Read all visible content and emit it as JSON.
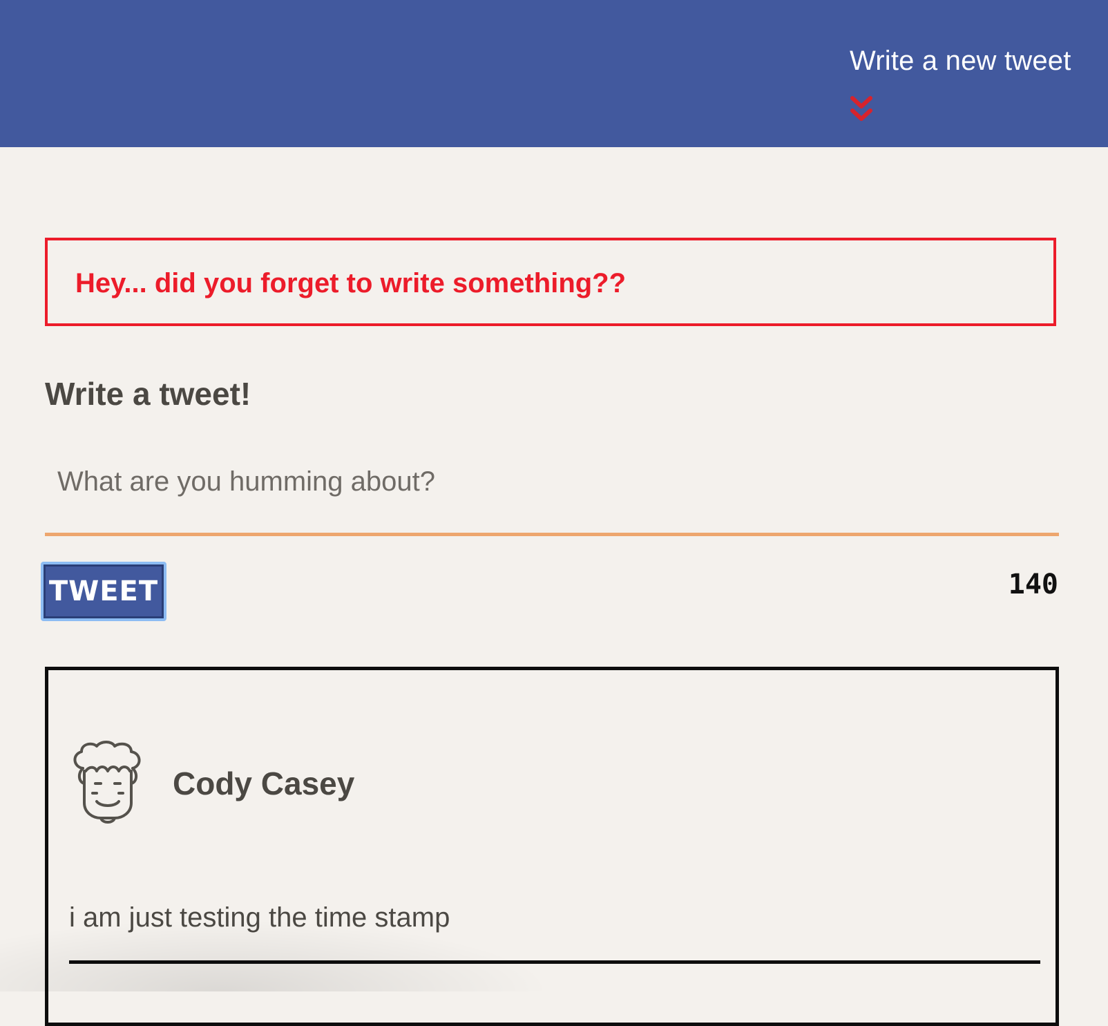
{
  "header": {
    "compose_toggle_label": "Write a new tweet",
    "chevron_icon": "double-chevron-down-icon",
    "background_color": "#42599e",
    "chevron_color": "#d7232d"
  },
  "alert": {
    "message": "Hey... did you forget to write something??",
    "color": "#ec1c2a"
  },
  "compose": {
    "heading": "Write a tweet!",
    "placeholder": "What are you humming about?",
    "value": "",
    "underline_color": "#eda66e",
    "submit_label": "TWEET",
    "char_counter": "140"
  },
  "tweets": [
    {
      "author": "Cody Casey",
      "avatar_icon": "curly-hair-face-avatar-icon",
      "content": "i am just testing the time stamp"
    }
  ]
}
